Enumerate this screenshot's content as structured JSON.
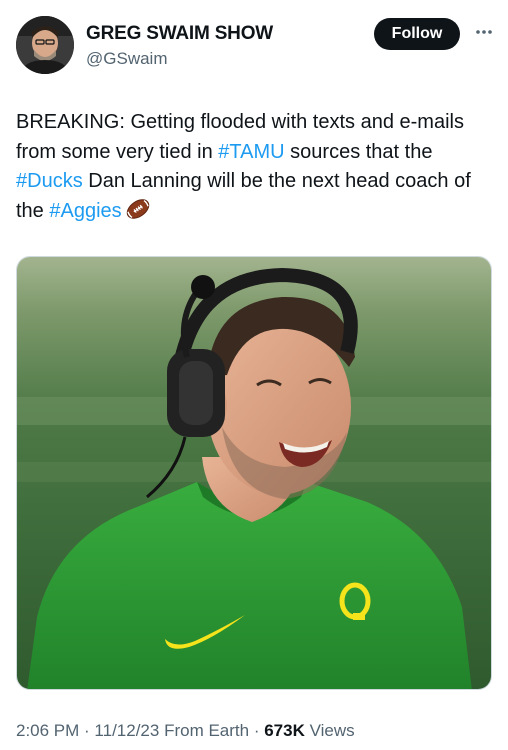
{
  "author": {
    "name": "GREG SWAIM SHOW",
    "handle": "@GSwaim",
    "follow_label": "Follow"
  },
  "tweet": {
    "text_1": "BREAKING: Getting flooded with texts and e-mails from some very tied in ",
    "hashtag_1": "#TAMU",
    "text_2": " sources that the ",
    "hashtag_2": "#Ducks",
    "text_3": " Dan Lanning will be the next head coach of the ",
    "hashtag_3": "#Aggies",
    "emoji": "american-football-icon"
  },
  "meta": {
    "time": "2:06 PM",
    "sep1": " · ",
    "date": "11/12/23",
    "source": " From Earth",
    "sep2": " · ",
    "views_count": "673K",
    "views_label": " Views"
  },
  "colors": {
    "link": "#1d9bf0",
    "text": "#0f1419",
    "secondary": "#536471",
    "shirt": "#2e9a36",
    "logo": "#f5e31c"
  }
}
